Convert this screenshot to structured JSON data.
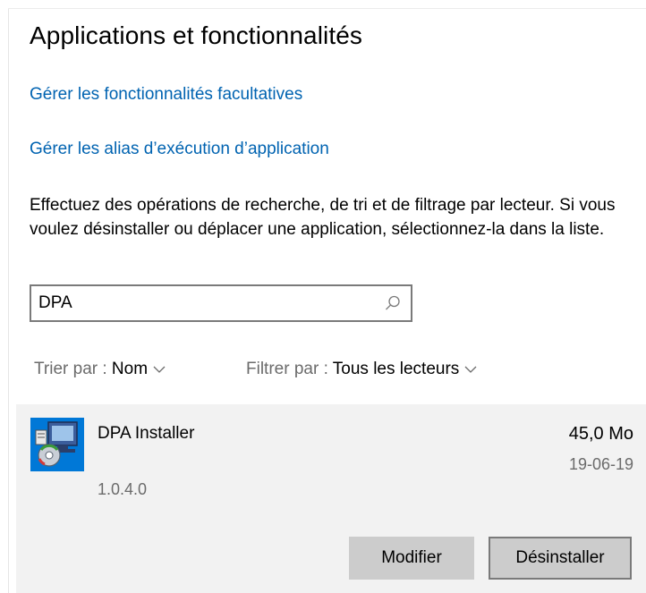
{
  "page": {
    "title": "Applications et fonctionnalités"
  },
  "links": {
    "optional_features": "Gérer les fonctionnalités facultatives",
    "execution_aliases": "Gérer les alias d’exécution d’application"
  },
  "description": "Effectuez des opérations de recherche, de tri et de filtrage par lecteur. Si vous voulez désinstaller ou déplacer une application, sélectionnez-la dans la liste.",
  "search": {
    "value": "DPA",
    "icon": "search-icon"
  },
  "sort": {
    "label": "Trier par : ",
    "value": "Nom"
  },
  "filter": {
    "label": "Filtrer par : ",
    "value": "Tous les lecteurs"
  },
  "apps": [
    {
      "name": "DPA Installer",
      "size": "45,0 Mo",
      "date": "19-06-19",
      "version": "1.0.4.0",
      "icon": "installer-icon",
      "buttons": {
        "modify": "Modifier",
        "uninstall": "Désinstaller"
      }
    }
  ],
  "colors": {
    "link": "#0063b1",
    "muted_text": "#6b6b6b",
    "card_background": "#f2f2f2",
    "button_background": "#cccccc",
    "icon_background": "#0078d7"
  }
}
